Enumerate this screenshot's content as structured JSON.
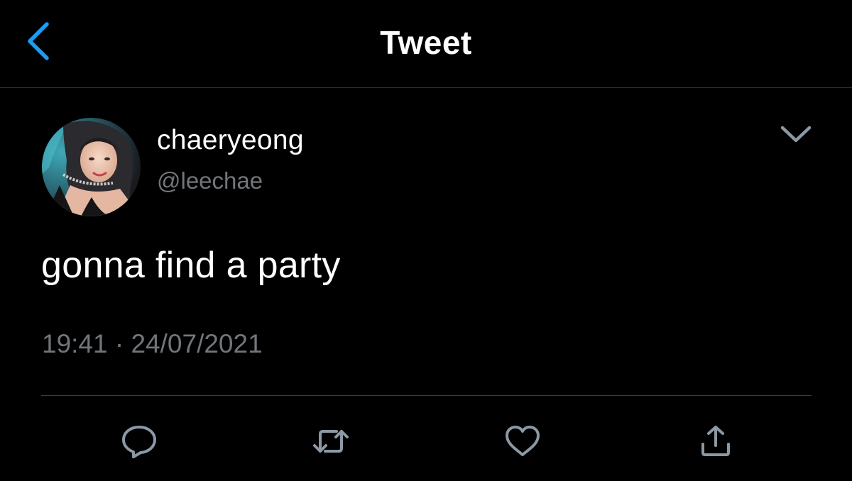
{
  "header": {
    "title": "Tweet",
    "back_icon": "chevron-left-icon"
  },
  "tweet": {
    "author": {
      "display_name": "chaeryeong",
      "handle": "@leechae",
      "avatar": "avatar-photo"
    },
    "text": "gonna find a party",
    "time": "19:41",
    "separator": "·",
    "date": "24/07/2021",
    "more_icon": "chevron-down-icon"
  },
  "actions": [
    {
      "name": "reply",
      "icon": "speech-bubble-icon"
    },
    {
      "name": "retweet",
      "icon": "retweet-icon"
    },
    {
      "name": "like",
      "icon": "heart-icon"
    },
    {
      "name": "share",
      "icon": "share-icon"
    }
  ],
  "colors": {
    "background": "#000000",
    "text_primary": "#ffffff",
    "text_secondary": "#71767b",
    "accent": "#1d9bf0",
    "icon_gray": "#8b98a5"
  }
}
